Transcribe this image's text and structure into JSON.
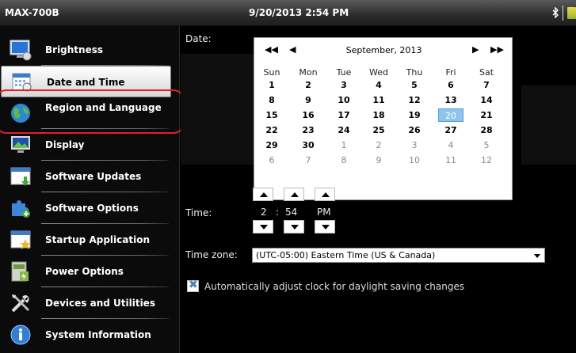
{
  "titlebar": {
    "device": "MAX-700B",
    "clock": "9/20/2013 2:54 PM",
    "bluetooth_icon": "bluetooth-icon",
    "battery_icon": "battery-icon"
  },
  "sidebar": {
    "items": [
      {
        "label": "Brightness",
        "icon": "brightness-icon"
      },
      {
        "label": "Date and Time",
        "icon": "calendar-icon",
        "selected": true
      },
      {
        "label": "Region and Language",
        "icon": "globe-icon"
      },
      {
        "label": "Display",
        "icon": "display-icon"
      },
      {
        "label": "Software Updates",
        "icon": "software-updates-icon"
      },
      {
        "label": "Software Options",
        "icon": "puzzle-icon"
      },
      {
        "label": "Startup Application",
        "icon": "startup-icon"
      },
      {
        "label": "Power Options",
        "icon": "power-icon"
      },
      {
        "label": "Devices and Utilities",
        "icon": "tools-icon"
      },
      {
        "label": "System Information",
        "icon": "info-icon"
      }
    ]
  },
  "date": {
    "label": "Date:",
    "calendar": {
      "month_title": "September, 2013",
      "prev_year": "◀◀",
      "prev_month": "◀",
      "next_month": "▶",
      "next_year": "▶▶",
      "weekdays": [
        "Sun",
        "Mon",
        "Tue",
        "Wed",
        "Thu",
        "Fri",
        "Sat"
      ],
      "weeks": [
        [
          "1",
          "2",
          "3",
          "4",
          "5",
          "6",
          "7"
        ],
        [
          "8",
          "9",
          "10",
          "11",
          "12",
          "13",
          "14"
        ],
        [
          "15",
          "16",
          "17",
          "18",
          "19",
          "20",
          "21"
        ],
        [
          "22",
          "23",
          "24",
          "25",
          "26",
          "27",
          "28"
        ],
        [
          "29",
          "30",
          "1",
          "2",
          "3",
          "4",
          "5"
        ],
        [
          "6",
          "7",
          "8",
          "9",
          "10",
          "11",
          "12"
        ]
      ],
      "selected_day": "20"
    }
  },
  "time": {
    "label": "Time:",
    "hour": "2",
    "separator": ":",
    "minute": "54",
    "ampm": "PM"
  },
  "timezone": {
    "label": "Time zone:",
    "value": "(UTC-05:00) Eastern Time (US & Canada)"
  },
  "dst": {
    "label": "Automatically adjust clock for daylight saving changes",
    "checked": true
  }
}
